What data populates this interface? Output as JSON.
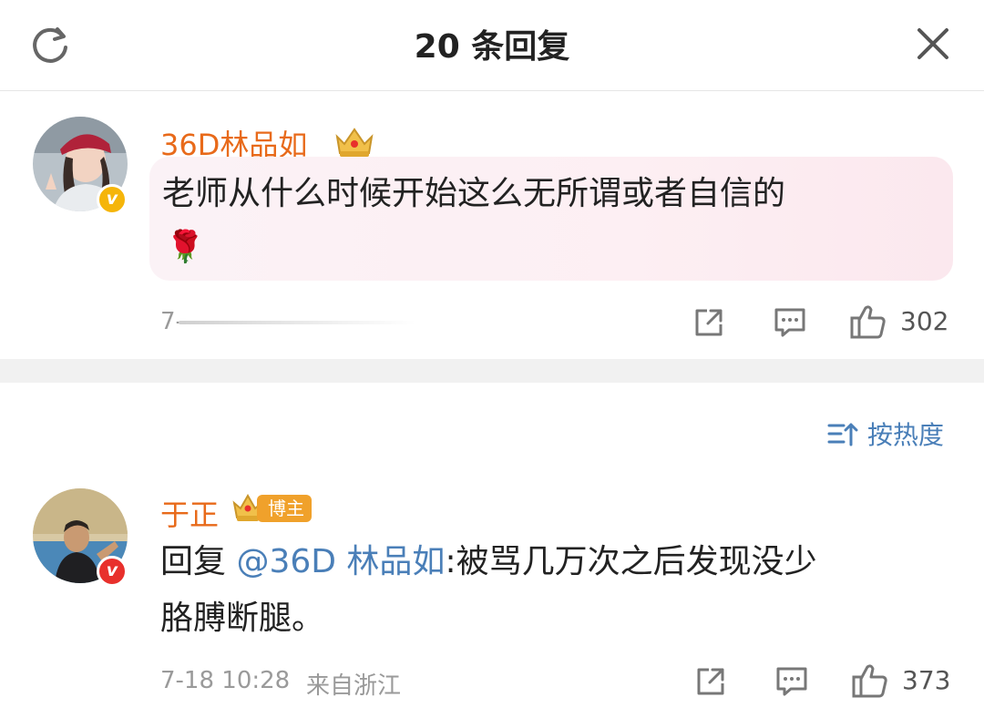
{
  "header": {
    "title": "20 条回复"
  },
  "root_comment": {
    "username": "36D林品如",
    "content_line1": "老师从什么时候开始这么无所谓或者自信的",
    "emoji": "🌹",
    "time": "7-",
    "like_count": "302"
  },
  "sort": {
    "label": "按热度"
  },
  "reply": {
    "username": "于正",
    "badge": "博主",
    "reply_prefix": "回复 ",
    "mention": "@36D 林品如",
    "content_line1_rest": ":被骂几万次之后发现没少",
    "content_line2": "胳膊断腿。",
    "time": "7-18 10:28",
    "source": "来自浙江",
    "like_count": "373"
  },
  "icons": {
    "refresh": "refresh-icon",
    "close": "close-icon",
    "share": "share-icon",
    "comment": "comment-icon",
    "like": "thumbs-up-icon",
    "sort": "sort-icon"
  },
  "colors": {
    "username": "#e86a1a",
    "mention": "#4a7fb8",
    "verified_yellow": "#f5b50a",
    "verified_red": "#e8302c",
    "badge_bozhu": "#f0a12b"
  }
}
